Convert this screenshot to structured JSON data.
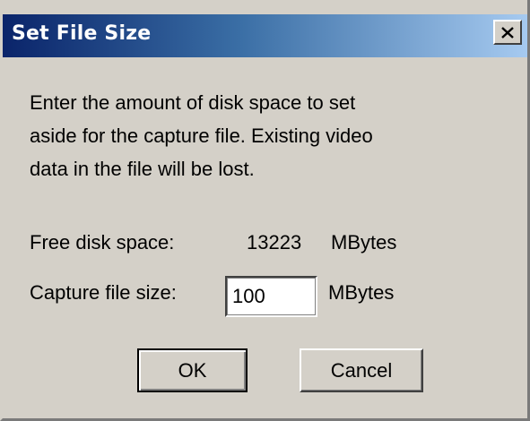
{
  "dialog": {
    "title": "Set File Size",
    "message": "Enter the amount of disk space to set\naside for the capture file.  Existing video\ndata in the file will be lost.",
    "free_space": {
      "label": "Free disk space:",
      "value": "13223",
      "unit": "MBytes"
    },
    "capture_size": {
      "label": "Capture file size:",
      "value": "100",
      "unit": "MBytes"
    },
    "buttons": {
      "ok": "OK",
      "cancel": "Cancel"
    },
    "close_icon": "close-x-icon",
    "colors": {
      "title_start": "#0a246a",
      "title_end": "#a6caf0",
      "face": "#d4d0c8"
    }
  }
}
